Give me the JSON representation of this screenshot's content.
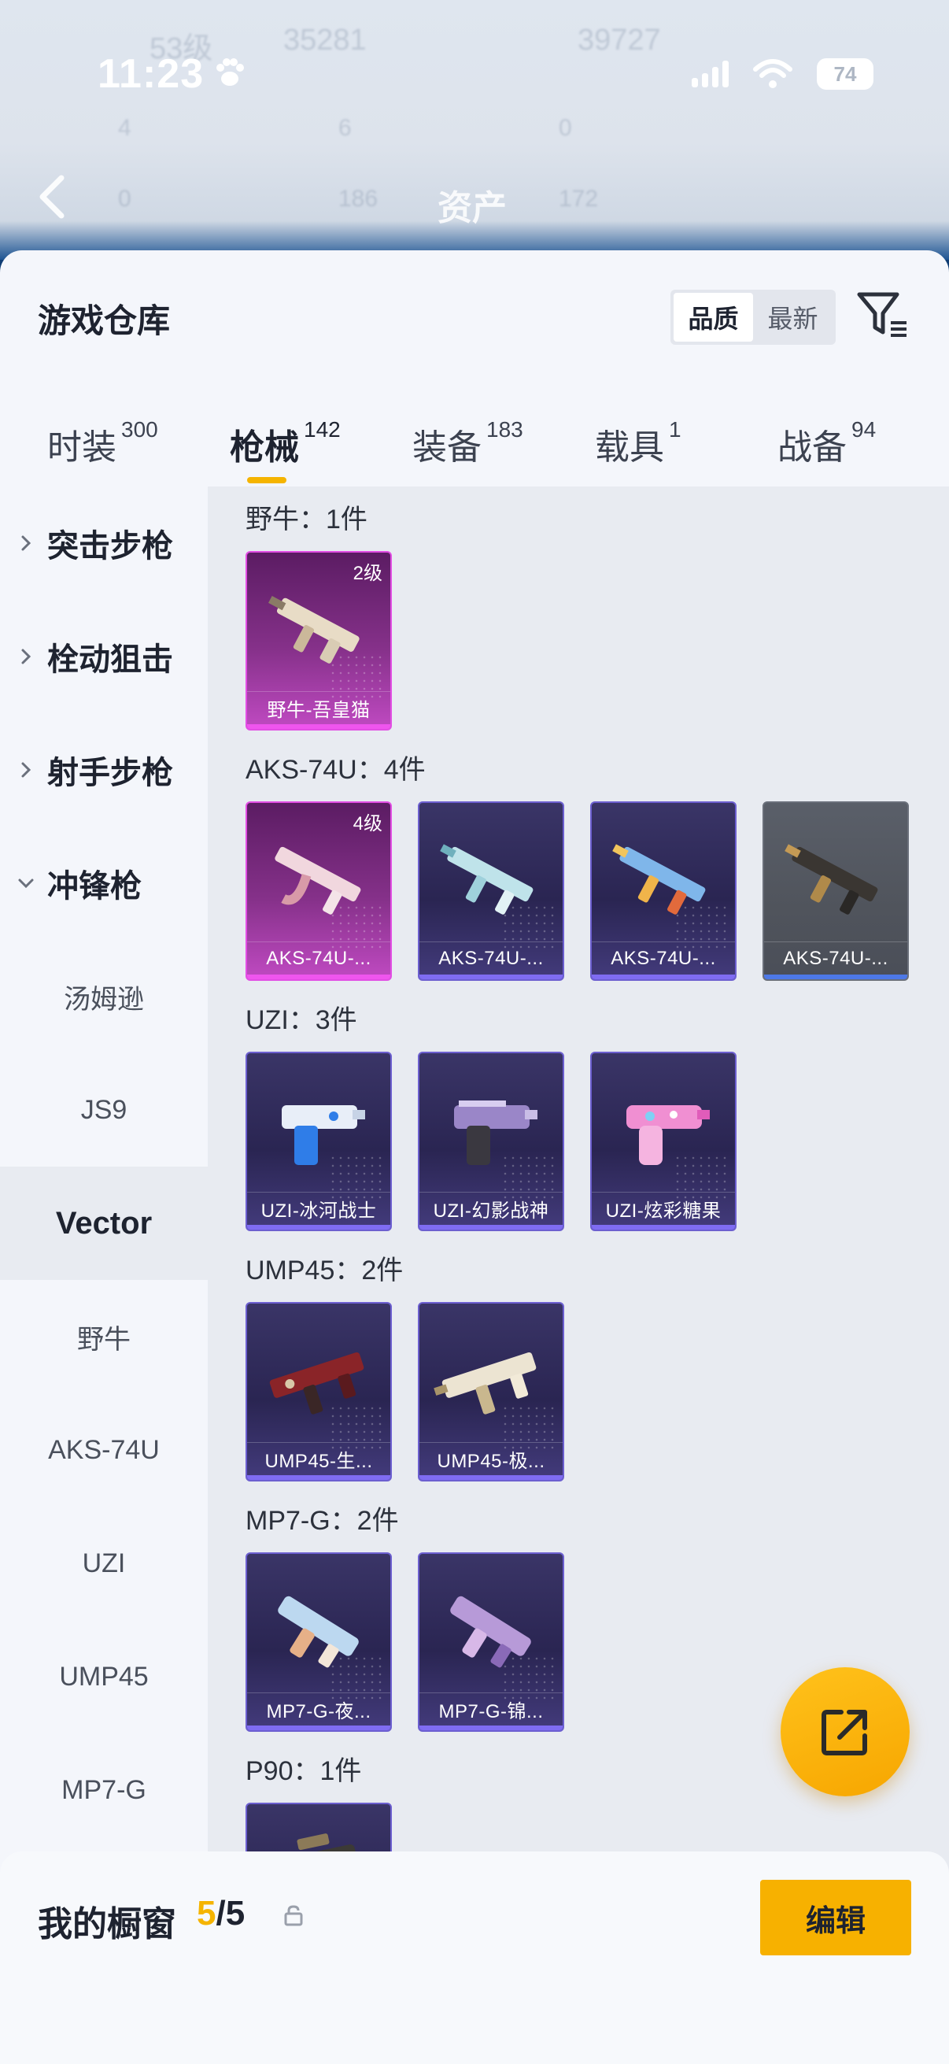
{
  "status_bar": {
    "time": "11:23",
    "battery": "74"
  },
  "header": {
    "title": "资产",
    "back_icon": "chevron-left-icon"
  },
  "background_ghost": {
    "level": "53级",
    "stat_a": "35281",
    "stat_b": "39727",
    "c1": "4",
    "c2": "6",
    "c3": "0",
    "c4": "0",
    "c5": "186",
    "c6": "172"
  },
  "warehouse": {
    "title": "游戏仓库",
    "sort": {
      "quality": "品质",
      "latest": "最新",
      "selected": "品质"
    },
    "filter_icon": "filter-icon"
  },
  "tabs": [
    {
      "label": "时装",
      "count": "300"
    },
    {
      "label": "枪械",
      "count": "142",
      "active": true
    },
    {
      "label": "装备",
      "count": "183"
    },
    {
      "label": "载具",
      "count": "1"
    },
    {
      "label": "战备",
      "count": "94"
    }
  ],
  "sidebar": {
    "categories": [
      {
        "label": "突击步枪",
        "expanded": false
      },
      {
        "label": "栓动狙击",
        "expanded": false
      },
      {
        "label": "射手步枪",
        "expanded": false
      },
      {
        "label": "冲锋枪",
        "expanded": true
      }
    ],
    "subitems": [
      "汤姆逊",
      "JS9",
      "Vector",
      "野牛",
      "AKS-74U",
      "UZI",
      "UMP45",
      "MP7-G"
    ],
    "selected": "Vector"
  },
  "groups": [
    {
      "title": "野牛：1件",
      "items": [
        {
          "name": "野牛-吾皇猫",
          "level": "2级",
          "rarity": "pink"
        }
      ]
    },
    {
      "title": "AKS-74U：4件",
      "items": [
        {
          "name": "AKS-74U-...",
          "level": "4级",
          "rarity": "pink"
        },
        {
          "name": "AKS-74U-...",
          "level": "",
          "rarity": "purple"
        },
        {
          "name": "AKS-74U-...",
          "level": "",
          "rarity": "purple"
        },
        {
          "name": "AKS-74U-...",
          "level": "",
          "rarity": "gray"
        }
      ]
    },
    {
      "title": "UZI：3件",
      "items": [
        {
          "name": "UZI-冰河战士",
          "level": "",
          "rarity": "purple"
        },
        {
          "name": "UZI-幻影战神",
          "level": "",
          "rarity": "purple"
        },
        {
          "name": "UZI-炫彩糖果",
          "level": "",
          "rarity": "purple"
        }
      ]
    },
    {
      "title": "UMP45：2件",
      "items": [
        {
          "name": "UMP45-生...",
          "level": "",
          "rarity": "purple"
        },
        {
          "name": "UMP45-极...",
          "level": "",
          "rarity": "purple"
        }
      ]
    },
    {
      "title": "MP7-G：2件",
      "items": [
        {
          "name": "MP7-G-夜...",
          "level": "",
          "rarity": "purple"
        },
        {
          "name": "MP7-G-锦...",
          "level": "",
          "rarity": "purple"
        }
      ]
    },
    {
      "title": "P90：1件",
      "items": [
        {
          "name": "",
          "level": "",
          "rarity": "purple"
        }
      ]
    }
  ],
  "share_icon": "share-icon",
  "showcase": {
    "label": "我的橱窗",
    "used": "5",
    "total": "5",
    "edit_label": "编辑"
  },
  "colors": {
    "accent": "#f5b400",
    "rarity_pink": "#e24ee4",
    "rarity_purple": "#6c5fd0",
    "rarity_gray": "#6a6f7a"
  }
}
